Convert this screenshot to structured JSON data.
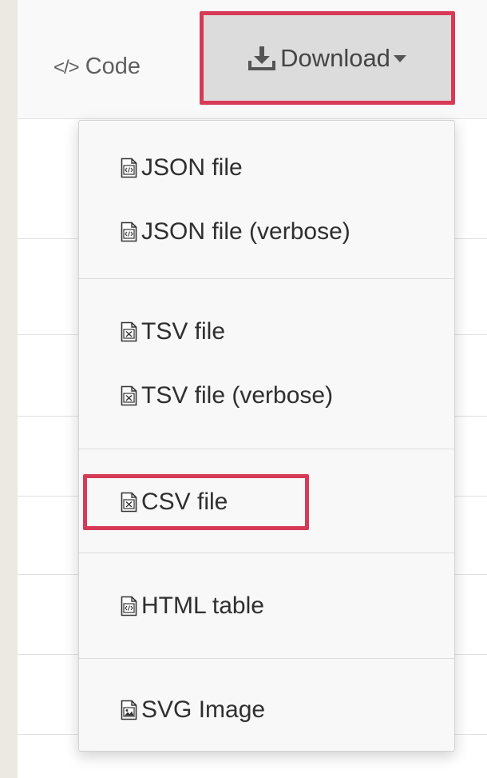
{
  "toolbar": {
    "code_glyph": "</>",
    "code_label": "Code",
    "download_label": "Download",
    "download_icon": "download-tray-icon",
    "caret_icon": "caret-down-icon"
  },
  "menu": {
    "items": [
      {
        "label": "JSON file",
        "icon": "code-file-icon"
      },
      {
        "label": "JSON file (verbose)",
        "icon": "code-file-icon"
      },
      {
        "label": "TSV file",
        "icon": "spreadsheet-file-icon"
      },
      {
        "label": "TSV file (verbose)",
        "icon": "spreadsheet-file-icon"
      },
      {
        "label": "CSV file",
        "icon": "spreadsheet-file-icon"
      },
      {
        "label": "HTML table",
        "icon": "code-file-icon"
      },
      {
        "label": "SVG Image",
        "icon": "image-file-icon"
      }
    ]
  },
  "highlight_color": "#d63a56"
}
